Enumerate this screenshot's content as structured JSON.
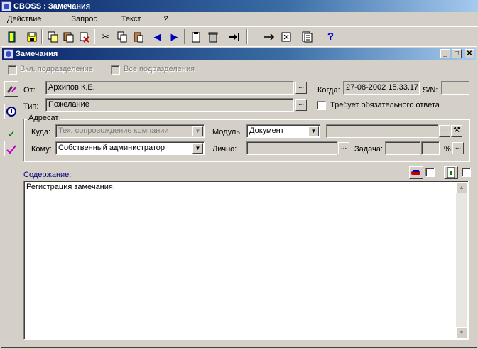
{
  "app": {
    "title": "CBOSS : Замечания"
  },
  "menu": {
    "items": [
      "Действие",
      "Запрос",
      "Текст",
      "?"
    ]
  },
  "toolbar": {
    "icons": [
      "exit-icon",
      "save-icon",
      "copy-record-icon",
      "paste-record-icon",
      "delete-record-icon",
      "cut-icon",
      "copy-icon",
      "paste-icon",
      "prev-icon",
      "next-icon",
      "clipboard-icon",
      "trash-icon",
      "goto-icon",
      "forward-icon",
      "close-form-icon",
      "report-icon",
      "help-icon"
    ]
  },
  "window": {
    "title": "Замечания",
    "min": "_",
    "max": "□",
    "close": "✕"
  },
  "filters": {
    "include_sub": "Вкл. подразделение",
    "all_sub": "Все подразделения"
  },
  "form": {
    "from_label": "От:",
    "from_value": "Архипов К.Е.",
    "when_label": "Когда:",
    "when_value": "27-08-2002 15.33.17",
    "sn_label": "S/N:",
    "sn_value": "",
    "type_label": "Тип:",
    "type_value": "Пожелание",
    "requires_answer_label": "Требует обязательного ответа",
    "dots": "...",
    "addressee_group": "Адресат",
    "where_label": "Куда:",
    "where_value": "Тех. сопровождение компании",
    "module_label": "Модуль:",
    "module_value": "Документ",
    "module_extra": "",
    "to_label": "Кому:",
    "to_value": "Собственный администратор",
    "personal_label": "Лично:",
    "personal_value": "",
    "task_label": "Задача:",
    "task_value": "",
    "task_pct": "",
    "percent": "%",
    "content_label": "Содержание:",
    "content_value": "Регистрация замечания."
  },
  "colors": {
    "titlebar": "#0a246a",
    "content_label": "#000080"
  }
}
